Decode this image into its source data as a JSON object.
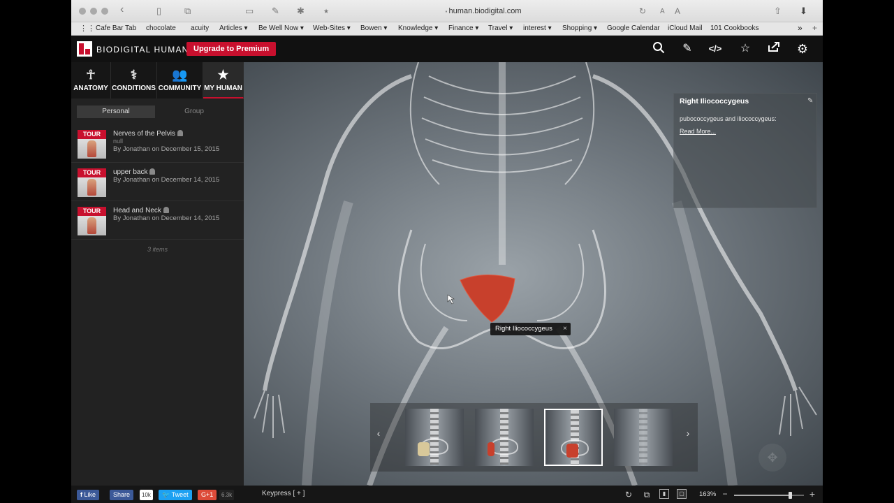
{
  "browser": {
    "url": "human.biodigital.com",
    "font_small": "A",
    "font_large": "A",
    "bookmarks": [
      "Cafe Bar Tab",
      "chocolate",
      "acuity",
      "Articles ▾",
      "Be Well Now ▾",
      "Web-Sites ▾",
      "Bowen ▾",
      "Knowledge ▾",
      "Finance ▾",
      "Travel ▾",
      "interest ▾",
      "Shopping ▾",
      "Google Calendar",
      "iCloud Mail",
      "101 Cookbooks"
    ],
    "bookmarks_more": "»"
  },
  "app": {
    "brand": "BIODIGITAL HUMAN",
    "upgrade_label": "Upgrade to Premium",
    "header_icons": [
      "search-icon",
      "pencil-icon",
      "embed-code-icon",
      "star-icon",
      "share-icon",
      "gear-icon"
    ]
  },
  "sidebar": {
    "tabs": [
      {
        "label": "ANATOMY",
        "icon": "human-figure-icon",
        "active": false
      },
      {
        "label": "CONDITIONS",
        "icon": "stethoscope-icon",
        "active": false
      },
      {
        "label": "COMMUNITY",
        "icon": "people-icon",
        "active": false
      },
      {
        "label": "MY HUMAN",
        "icon": "star-icon",
        "active": true
      }
    ],
    "subtabs": [
      {
        "label": "Personal",
        "active": true
      },
      {
        "label": "Group",
        "active": false
      }
    ],
    "items": [
      {
        "badge": "TOUR",
        "title": "Nerves of the Pelvis",
        "subtitle": "null",
        "byline": "By Jonathan on December 15, 2015"
      },
      {
        "badge": "TOUR",
        "title": "upper back",
        "byline": "By Jonathan on December 14, 2015"
      },
      {
        "badge": "TOUR",
        "title": "Head and Neck",
        "byline": "By Jonathan on December 14, 2015"
      }
    ],
    "count_label": "3 items"
  },
  "viewer": {
    "info_panel": {
      "title": "Right Iliococcygeus",
      "description": "pubococcygeus and iliococcygeus:",
      "read_more": "Read More..."
    },
    "label_tag": "Right Iliococcygeus",
    "label_close": "×",
    "carousel": {
      "prev": "‹",
      "next": "›",
      "selected_index": 2,
      "slide_count": 4
    },
    "colors": {
      "highlight_muscle": "#c8402c",
      "background": "#6f777e"
    }
  },
  "bottom_bar": {
    "like_label": "Like",
    "share_label": "Share",
    "like_count": "10k",
    "tweet_label": "Tweet",
    "gplus_label": "G+1",
    "gplus_count": "6.3k",
    "keypress": "Keypress [ + ]",
    "zoom": "163%",
    "zoom_minus": "−",
    "zoom_plus": "+",
    "zoom_fraction": 0.8,
    "colors": {
      "facebook": "#3b5998",
      "twitter": "#1da1f2",
      "gplus": "#dd4b39"
    }
  }
}
